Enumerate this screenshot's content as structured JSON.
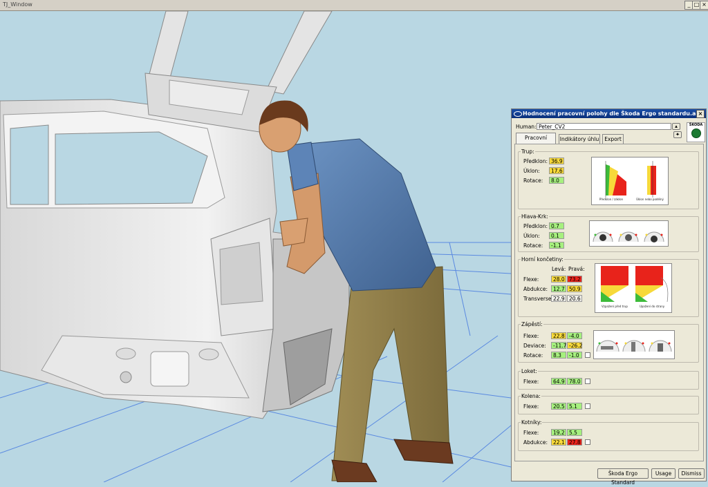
{
  "window": {
    "title": "TJ_Window",
    "controls": [
      "_",
      "□",
      "×"
    ]
  },
  "panel": {
    "title": "Hodnocení pracovní polohy dle Škoda Ergo standardu.alfa",
    "close": "×",
    "human_label": "Human:",
    "human_value": "Peter_CV2",
    "logo_text": "ŠKODA",
    "tabs": [
      "Pracovní polohy",
      "Indikátory úhlu",
      "Export"
    ],
    "trup": {
      "title": "Trup:",
      "rows": [
        {
          "label": "Předklon:",
          "v": "36.9",
          "c": "y"
        },
        {
          "label": "Úklon:",
          "v": "17.6",
          "c": "y"
        },
        {
          "label": "Rotace:",
          "v": "8.0",
          "c": "g"
        }
      ],
      "captions": [
        "Předklon / záklon",
        "Úklon nebo podélný"
      ]
    },
    "hlava": {
      "title": "Hlava-Krk:",
      "rows": [
        {
          "label": "Předklon:",
          "v": "0.7",
          "c": "g"
        },
        {
          "label": "Úklon:",
          "v": "0.1",
          "c": "g"
        },
        {
          "label": "Rotace:",
          "v": "-1.1",
          "c": "g"
        }
      ]
    },
    "horni": {
      "title": "Horní končetiny:",
      "col_left": "Levá:",
      "col_right": "Pravá:",
      "rows": [
        {
          "label": "Flexe:",
          "l": "28.0",
          "lc": "y",
          "r": "73.2",
          "rc": "r"
        },
        {
          "label": "Abdukce:",
          "l": "12.7",
          "lc": "g",
          "r": "50.9",
          "rc": "y"
        },
        {
          "label": "Transverse:",
          "l": "22.9",
          "lc": "n",
          "r": "20.6",
          "rc": "n"
        }
      ],
      "captions": [
        "Vzpažení před trup",
        "Upažení do strany"
      ]
    },
    "zapesti": {
      "title": "Zápěstí:",
      "rows": [
        {
          "label": "Flexe:",
          "l": "22.8",
          "lc": "y",
          "r": "-4.0",
          "rc": "g"
        },
        {
          "label": "Deviace:",
          "l": "-11.7",
          "lc": "g",
          "r": "-26.2",
          "rc": "y"
        },
        {
          "label": "Rotace:",
          "l": "8.3",
          "lc": "g",
          "r": "-1.0",
          "rc": "g"
        }
      ]
    },
    "loket": {
      "title": "Loket:",
      "rows": [
        {
          "label": "Flexe:",
          "l": "64.9",
          "lc": "g",
          "r": "78.0",
          "rc": "g"
        }
      ]
    },
    "kolena": {
      "title": "Kolena:",
      "rows": [
        {
          "label": "Flexe:",
          "l": "20.5",
          "lc": "g",
          "r": "5.1",
          "rc": "g"
        }
      ]
    },
    "kotniky": {
      "title": "Kotníky:",
      "rows": [
        {
          "label": "Flexe:",
          "l": "19.2",
          "lc": "g",
          "r": "5.5",
          "rc": "g"
        },
        {
          "label": "Abdukce:",
          "l": "22.1",
          "lc": "y",
          "r": "27.8",
          "rc": "r"
        }
      ]
    },
    "buttons": [
      "Škoda Ergo Standard",
      "Usage",
      "Dismiss"
    ]
  },
  "colors": {
    "green": "#a6f07e",
    "yellow": "#f7d93a",
    "red": "#e8231b",
    "sky": "#b9d7e3",
    "grid": "#3a6fe0"
  }
}
